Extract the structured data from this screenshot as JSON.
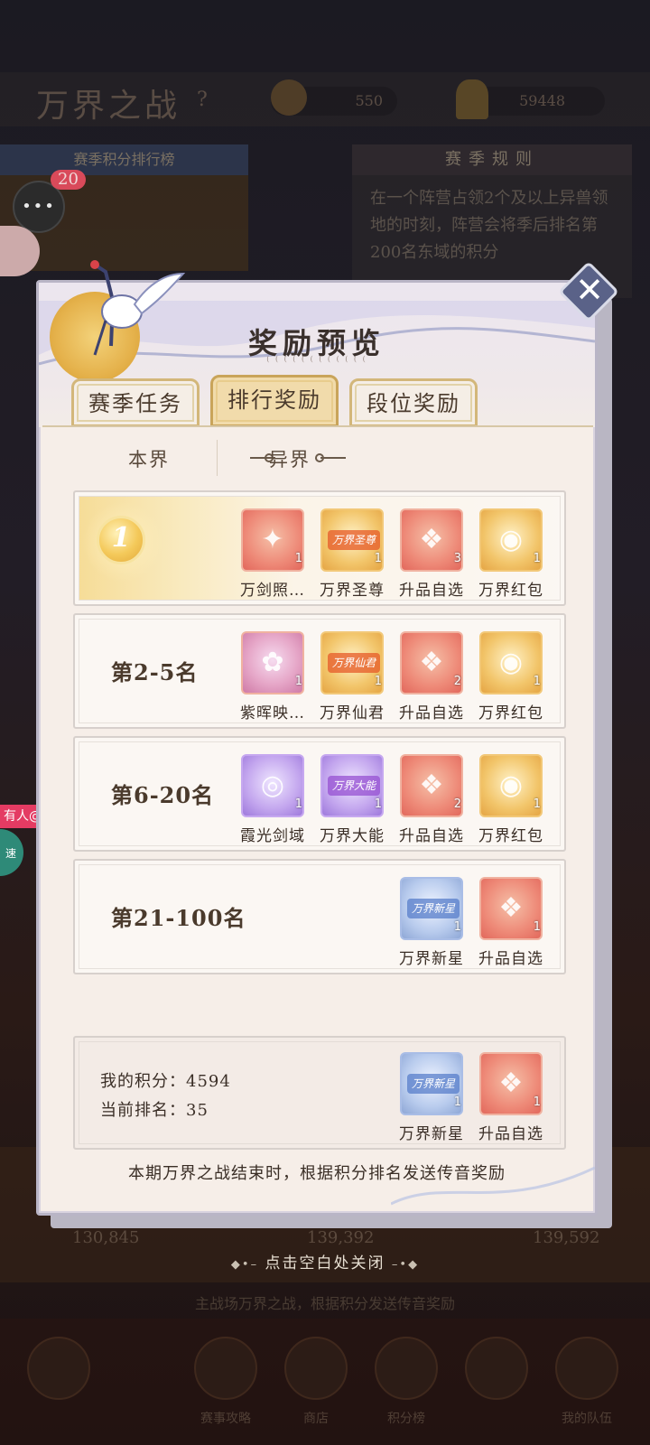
{
  "background": {
    "title": "万界之战",
    "help_icon": "?",
    "resource_1_value": "550",
    "resource_2_value": "59448",
    "left_panel_title": "赛季积分排行榜",
    "right_panel_title": "赛季规则",
    "right_panel_text": "在一个阵营占领2个及以上异兽领地的时刻，阵营会将季后排名第200名东域的积分",
    "bottom_values": [
      "130,845",
      "139,392",
      "139,592"
    ],
    "bottom_hint": "主战场万界之战，根据积分发送传音奖励",
    "nav_labels": [
      "赛事攻略",
      "商店",
      "积分榜",
      "",
      "我的队伍"
    ]
  },
  "chat": {
    "dots": "•••",
    "unread": "20"
  },
  "side": {
    "mention": "有人@你",
    "speed": "速"
  },
  "modal": {
    "title": "奖励预览",
    "title_sub": "( ( ( ( ( ( ( ( ( ( ( (",
    "close_icon": "✕",
    "tabs": [
      "赛季任务",
      "排行奖励",
      "段位奖励"
    ],
    "active_tab": 1,
    "subtabs": [
      "本界",
      "异界"
    ],
    "active_subtab": 1,
    "rows": [
      {
        "rank_number": "1",
        "rank_label": "",
        "items": [
          {
            "name": "万剑照…",
            "count": "1",
            "style": "red",
            "icon": "sword-orb-icon"
          },
          {
            "name": "万界圣尊",
            "count": "1",
            "style": "gold",
            "icon": "title-banner-icon",
            "banner": "万界圣尊"
          },
          {
            "name": "升品自选",
            "count": "3",
            "style": "red",
            "icon": "lucky-bag-icon"
          },
          {
            "name": "万界红包",
            "count": "1",
            "style": "gold",
            "icon": "red-envelope-icon"
          }
        ]
      },
      {
        "rank_label": "第2-5名",
        "items": [
          {
            "name": "紫晖映…",
            "count": "1",
            "style": "rose",
            "icon": "purple-lotus-icon"
          },
          {
            "name": "万界仙君",
            "count": "1",
            "style": "gold",
            "icon": "title-banner-icon",
            "banner": "万界仙君"
          },
          {
            "name": "升品自选",
            "count": "2",
            "style": "red",
            "icon": "lucky-bag-icon"
          },
          {
            "name": "万界红包",
            "count": "1",
            "style": "gold",
            "icon": "red-envelope-icon"
          }
        ]
      },
      {
        "rank_label": "第6-20名",
        "items": [
          {
            "name": "霞光剑域",
            "count": "1",
            "style": "purple",
            "icon": "sword-ring-icon"
          },
          {
            "name": "万界大能",
            "count": "1",
            "style": "purple",
            "icon": "title-banner-icon",
            "banner": "万界大能"
          },
          {
            "name": "升品自选",
            "count": "2",
            "style": "red",
            "icon": "lucky-bag-icon"
          },
          {
            "name": "万界红包",
            "count": "1",
            "style": "gold",
            "icon": "red-envelope-icon"
          }
        ]
      },
      {
        "rank_label": "第21-100名",
        "items": [
          {
            "name": "万界新星",
            "count": "1",
            "style": "blue",
            "icon": "title-banner-icon",
            "banner": "万界新星"
          },
          {
            "name": "升品自选",
            "count": "1",
            "style": "red",
            "icon": "lucky-bag-icon"
          }
        ]
      }
    ],
    "my_score_label": "我的积分：",
    "my_score_value": "4594",
    "my_rank_label": "当前排名：",
    "my_rank_value": "35",
    "my_rewards": [
      {
        "name": "万界新星",
        "count": "1",
        "style": "blue",
        "icon": "title-banner-icon",
        "banner": "万界新星"
      },
      {
        "name": "升品自选",
        "count": "1",
        "style": "red",
        "icon": "lucky-bag-icon"
      }
    ],
    "footer_note": "本期万界之战结束时，根据积分排名发送传音奖励"
  },
  "tap_to_close": "点击空白处关闭",
  "colors": {
    "modal_bg": "#f6eee8",
    "tab_active": "#f1dbab",
    "tab_border": "#d3b77a",
    "close_button": "#5a6288",
    "mention_pill": "#e43b63",
    "speed_button": "#2e8a78"
  }
}
